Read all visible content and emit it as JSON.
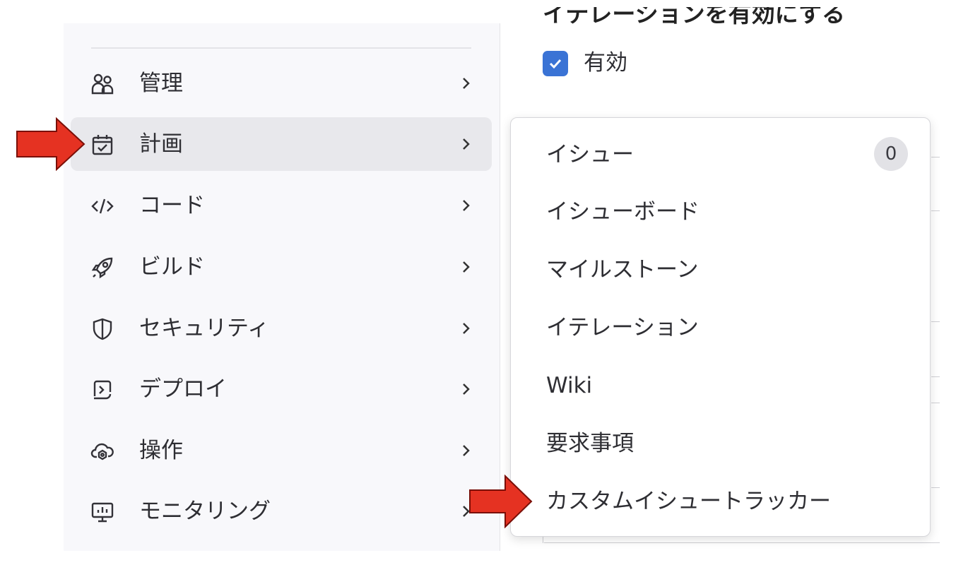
{
  "sidebar": {
    "items": [
      {
        "label": "管理",
        "icon": "users-icon"
      },
      {
        "label": "計画",
        "icon": "calendar-check-icon",
        "active": true
      },
      {
        "label": "コード",
        "icon": "code-icon"
      },
      {
        "label": "ビルド",
        "icon": "rocket-icon"
      },
      {
        "label": "セキュリティ",
        "icon": "shield-icon"
      },
      {
        "label": "デプロイ",
        "icon": "deploy-icon"
      },
      {
        "label": "操作",
        "icon": "cloud-gear-icon"
      },
      {
        "label": "モニタリング",
        "icon": "monitor-icon"
      }
    ]
  },
  "main": {
    "section_heading_fragment": "イテレーションを有効にする",
    "checkbox": {
      "label": "有効",
      "checked": true
    }
  },
  "flyout": {
    "items": [
      {
        "label": "イシュー",
        "badge": "0"
      },
      {
        "label": "イシューボード"
      },
      {
        "label": "マイルストーン"
      },
      {
        "label": "イテレーション"
      },
      {
        "label": "Wiki"
      },
      {
        "label": "要求事項"
      },
      {
        "label": "カスタムイシュートラッカー"
      }
    ]
  },
  "annotations": {
    "arrow_color": "#e53222"
  },
  "colors": {
    "accent": "#3a73d5",
    "active_bg": "#e8e8ec",
    "sidebar_bg": "#f8f8fb"
  }
}
